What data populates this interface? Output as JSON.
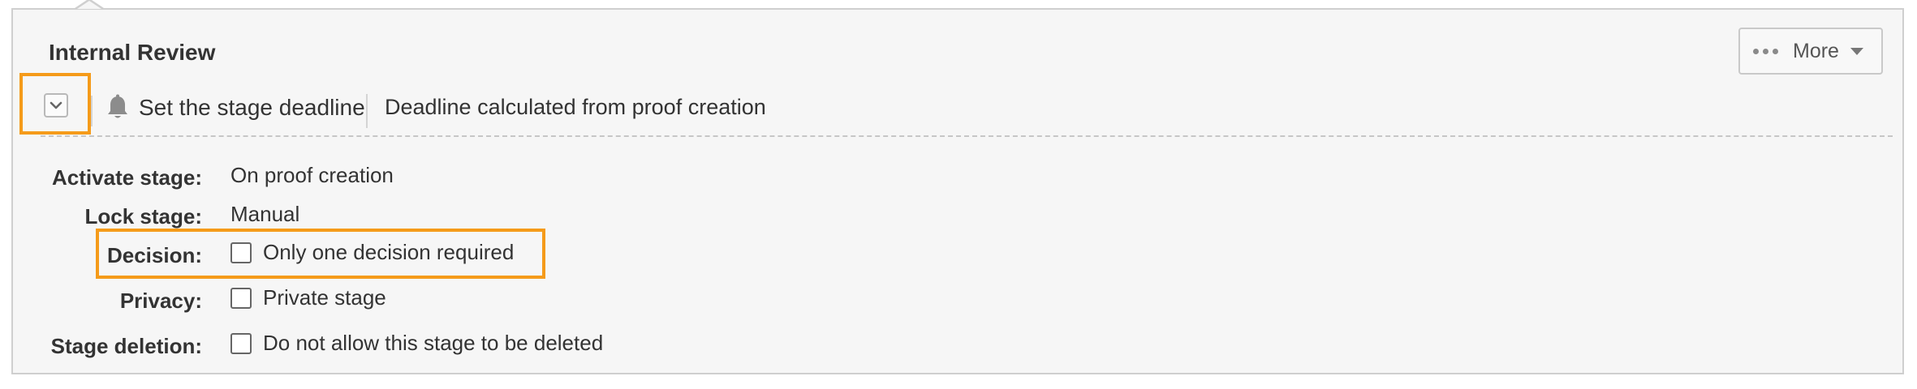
{
  "stage": {
    "title": "Internal Review",
    "more_label": "More",
    "deadline_link": "Set the stage deadline",
    "deadline_info": "Deadline calculated from proof creation"
  },
  "settings": [
    {
      "label": "Activate stage:",
      "value": "On proof creation"
    },
    {
      "label": "Lock stage:",
      "value": "Manual"
    },
    {
      "label": "Decision:",
      "value": "Only one decision required",
      "checked": false
    },
    {
      "label": "Privacy:",
      "value": "Private stage",
      "checked": false
    },
    {
      "label": "Stage deletion:",
      "value": "Do not allow this stage to be deleted",
      "checked": false
    }
  ],
  "icons": {
    "more": "ellipsis-icon",
    "dropdown": "caret-down-icon",
    "collapse": "chevron-down-icon",
    "deadline": "bell-icon"
  },
  "colors": {
    "highlight": "#f59b1a",
    "panel_bg": "#f6f6f6",
    "panel_border": "#cfcfcf"
  }
}
